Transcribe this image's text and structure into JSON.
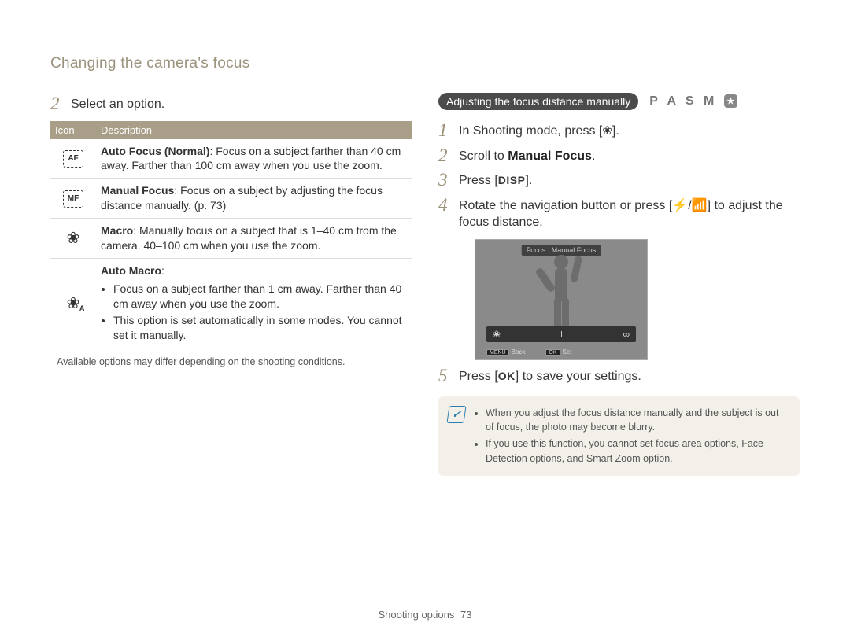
{
  "page": {
    "section_title": "Changing the camera's focus",
    "footer_label": "Shooting options",
    "page_number": "73"
  },
  "left": {
    "step2_num": "2",
    "step2_text": "Select an option.",
    "table": {
      "head_icon": "Icon",
      "head_desc": "Description",
      "rows": [
        {
          "icon_label": "AF",
          "title": "Auto Focus (Normal)",
          "body": ": Focus on a subject farther than 40 cm away. Farther than 100 cm away when you use the zoom."
        },
        {
          "icon_label": "MF",
          "title": "Manual Focus",
          "body": ": Focus on a subject by adjusting the focus distance manually. (p. 73)"
        },
        {
          "icon_label": "macro",
          "title": "Macro",
          "body": ": Manually focus on a subject that is 1–40 cm from the camera. 40–100 cm when you use the zoom."
        },
        {
          "icon_label": "auto-macro",
          "title": "Auto Macro",
          "body": ":",
          "bullets": [
            "Focus on a subject farther than 1 cm away. Farther than 40 cm away when you use the zoom.",
            "This option is set automatically in some modes. You cannot set it manually."
          ]
        }
      ]
    },
    "note": "Available options may differ depending on the shooting conditions."
  },
  "right": {
    "pill": "Adjusting the focus distance manually",
    "modes": "P A S M",
    "steps": {
      "s1_num": "1",
      "s1_a": "In Shooting mode, press [",
      "s1_b": "].",
      "s2_num": "2",
      "s2_a": "Scroll to ",
      "s2_b": "Manual Focus",
      "s2_c": ".",
      "s3_num": "3",
      "s3_a": "Press [",
      "s3_key": "DISP",
      "s3_b": "].",
      "s4_num": "4",
      "s4_a": "Rotate the navigation button or press [",
      "s4_b": "/",
      "s4_c": "] to adjust the focus distance.",
      "s5_num": "5",
      "s5_a": "Press [",
      "s5_key": "OK",
      "s5_b": "] to save your settings."
    },
    "screenshot": {
      "label": "Focus : Manual Focus",
      "back_key": "MENU",
      "back_label": "Back",
      "set_key": "OK",
      "set_label": "Set"
    },
    "info": {
      "bullets": [
        "When you adjust the focus distance manually and the subject is out of focus, the photo may become blurry.",
        "If you use this function, you cannot set focus area options, Face Detection options, and Smart Zoom option."
      ]
    }
  }
}
